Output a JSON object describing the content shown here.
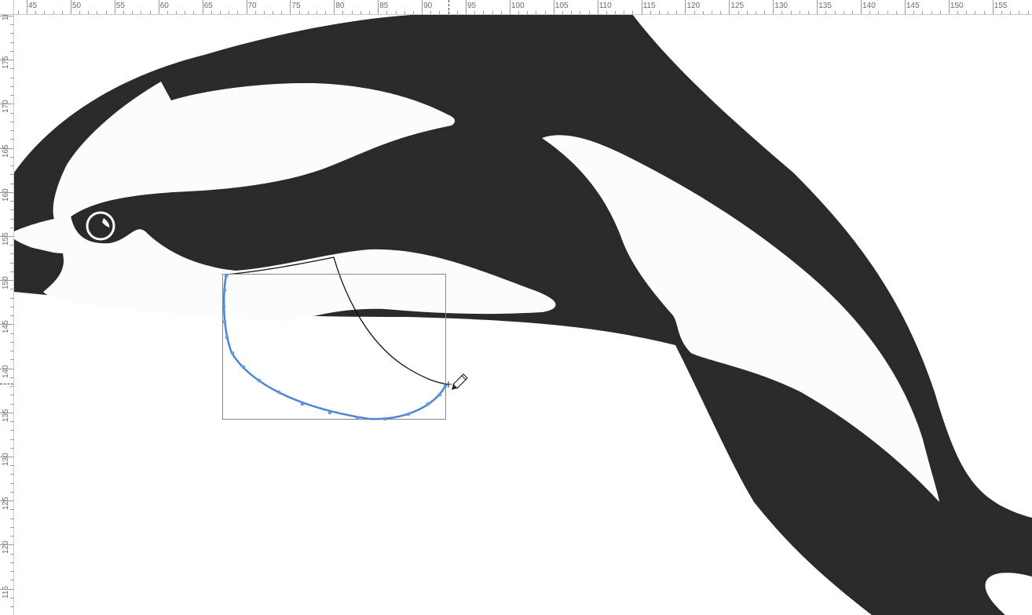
{
  "rulers": {
    "horizontal": [
      "45",
      "50",
      "55",
      "60",
      "65",
      "70",
      "75",
      "80",
      "85",
      "90",
      "95",
      "100",
      "105",
      "110",
      "115",
      "120",
      "125",
      "130",
      "135",
      "140",
      "145",
      "150",
      "155"
    ],
    "vertical": [
      "18",
      "175",
      "170",
      "165",
      "160",
      "155",
      "150",
      "145",
      "140",
      "135",
      "130",
      "125",
      "120",
      "115"
    ]
  },
  "canvas": {
    "artwork": "orca-illustration",
    "fill_color": "#2b2a29",
    "light_color": "#fcfcfc",
    "selection_stroke": "#8a8a8a",
    "active_curve_color": "#4a86d6",
    "tool": "pencil-icon"
  }
}
